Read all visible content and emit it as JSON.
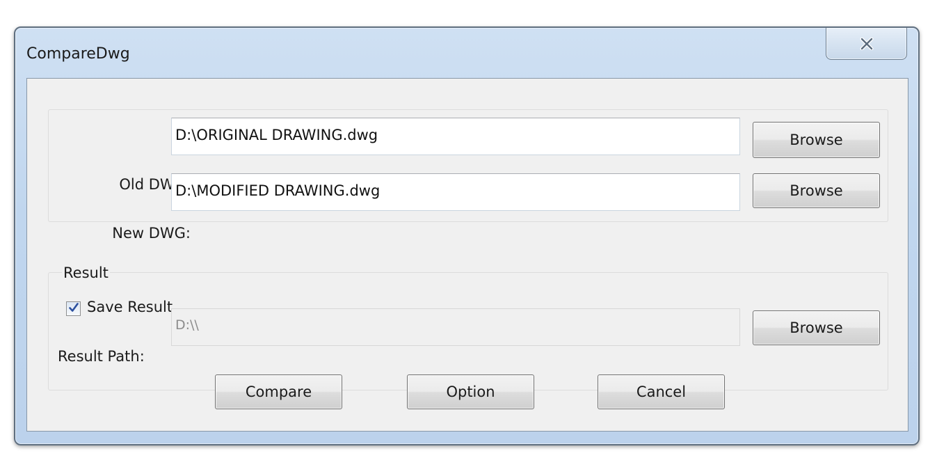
{
  "window": {
    "title": "CompareDwg",
    "close_icon": "close-x-icon"
  },
  "dwg_group": {
    "old_label": "Old DWG:",
    "old_value": "D:\\ORIGINAL DRAWING.dwg",
    "old_browse": "Browse",
    "new_label": "New DWG:",
    "new_value": "D:\\MODIFIED DRAWING.dwg",
    "new_browse": "Browse"
  },
  "result_group": {
    "title": "Result",
    "save_result_label": "Save Result",
    "save_result_checked": true,
    "path_label": "Result Path:",
    "path_value": "D:\\\\",
    "path_browse": "Browse"
  },
  "actions": {
    "compare": "Compare",
    "option": "Option",
    "cancel": "Cancel"
  }
}
